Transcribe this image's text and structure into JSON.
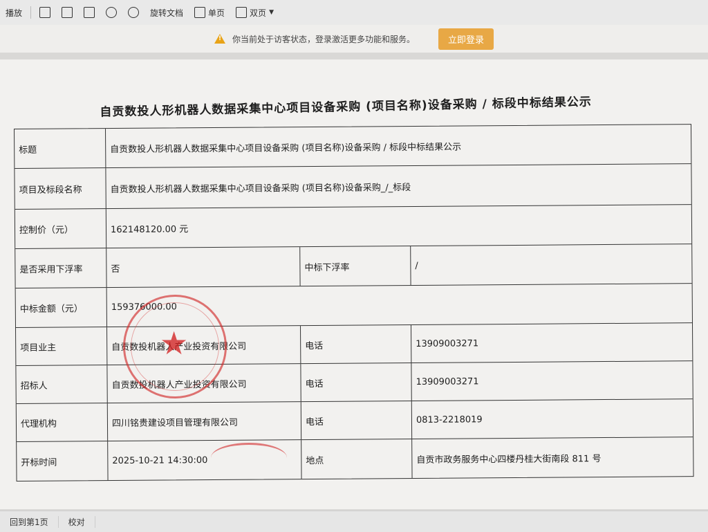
{
  "toolbar": {
    "items": [
      {
        "label": "播放",
        "icon": "play-icon"
      },
      {
        "label": "",
        "icon": "fit-page-icon"
      },
      {
        "label": "",
        "icon": "fit-width-icon"
      },
      {
        "label": "",
        "icon": "actual-size-icon"
      },
      {
        "label": "",
        "icon": "rotate-left-icon"
      },
      {
        "label": "",
        "icon": "rotate-right-icon"
      },
      {
        "label": "旋转文档",
        "icon": "rotate-doc-icon"
      },
      {
        "label": "单页",
        "icon": "single-page-icon"
      },
      {
        "label": "双页",
        "icon": "double-page-icon"
      }
    ]
  },
  "notice": {
    "message": "你当前处于访客状态，登录激活更多功能和服务。",
    "login_label": "立即登录",
    "login_color": "#e8a845"
  },
  "document": {
    "title": "自贡数投人形机器人数据采集中心项目设备采购 (项目名称)设备采购 / 标段中标结果公示",
    "rows": [
      {
        "label": "标题",
        "value": "自贡数投人形机器人数据采集中心项目设备采购 (项目名称)设备采购 / 标段中标结果公示"
      },
      {
        "label": "项目及标段名称",
        "value": "自贡数投人形机器人数据采集中心项目设备采购 (项目名称)设备采购_/_标段"
      },
      {
        "label": "控制价（元）",
        "value": "162148120.00 元"
      },
      {
        "label": "是否采用下浮率",
        "value": "否",
        "label2": "中标下浮率",
        "value2": "/"
      },
      {
        "label": "中标金额（元）",
        "value": "159376000.00"
      },
      {
        "label": "项目业主",
        "value": "自贡数投机器人产业投资有限公司",
        "label2": "电话",
        "value2": "13909003271"
      },
      {
        "label": "招标人",
        "value": "自贡数投机器人产业投资有限公司",
        "label2": "电话",
        "value2": "13909003271"
      },
      {
        "label": "代理机构",
        "value": "四川铭贵建设项目管理有限公司",
        "label2": "电话",
        "value2": "0813-2218019"
      },
      {
        "label": "开标时间",
        "value": "2025-10-21 14:30:00",
        "label2": "地点",
        "value2": "自贡市政务服务中心四楼丹桂大街南段 811 号"
      }
    ]
  },
  "statusbar": {
    "back_label": "回到第1页",
    "proofread_label": "校对"
  }
}
